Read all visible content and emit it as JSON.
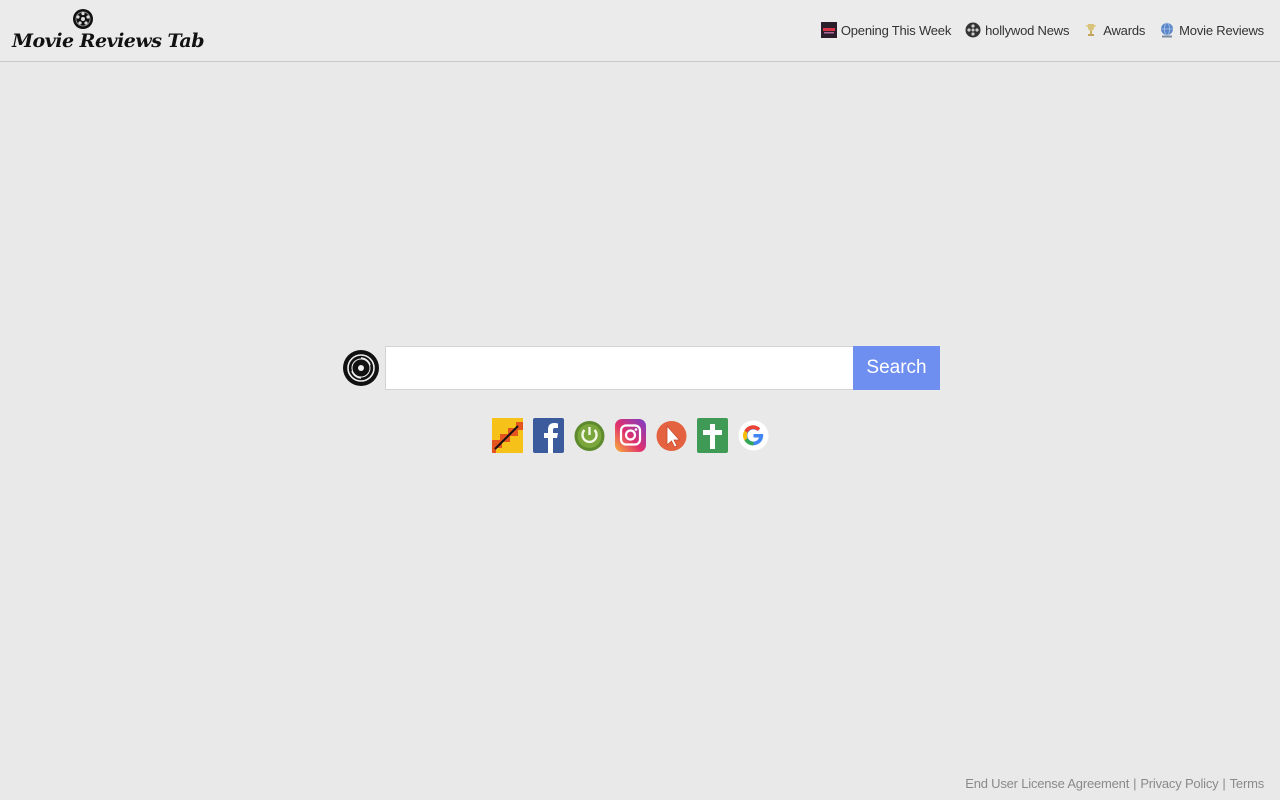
{
  "header": {
    "logo_text": "Movie Reviews Tab",
    "nav": [
      {
        "label": "Opening This Week",
        "icon": "film-ticket-icon"
      },
      {
        "label": "hollywod News",
        "icon": "film-reel-icon"
      },
      {
        "label": "Awards",
        "icon": "trophy-icon"
      },
      {
        "label": "Movie Reviews",
        "icon": "globe-icon"
      }
    ]
  },
  "search": {
    "value": "",
    "placeholder": "",
    "button_label": "Search",
    "button_color": "#6e8ef0"
  },
  "shortcuts": [
    {
      "icon": "staircase-app-icon"
    },
    {
      "icon": "facebook-icon"
    },
    {
      "icon": "power-icon"
    },
    {
      "icon": "instagram-icon"
    },
    {
      "icon": "cursor-icon"
    },
    {
      "icon": "cross-icon"
    },
    {
      "icon": "google-icon"
    }
  ],
  "footer": {
    "eula": "End User License Agreement",
    "privacy": "Privacy Policy",
    "terms": "Terms",
    "separator": "|"
  }
}
